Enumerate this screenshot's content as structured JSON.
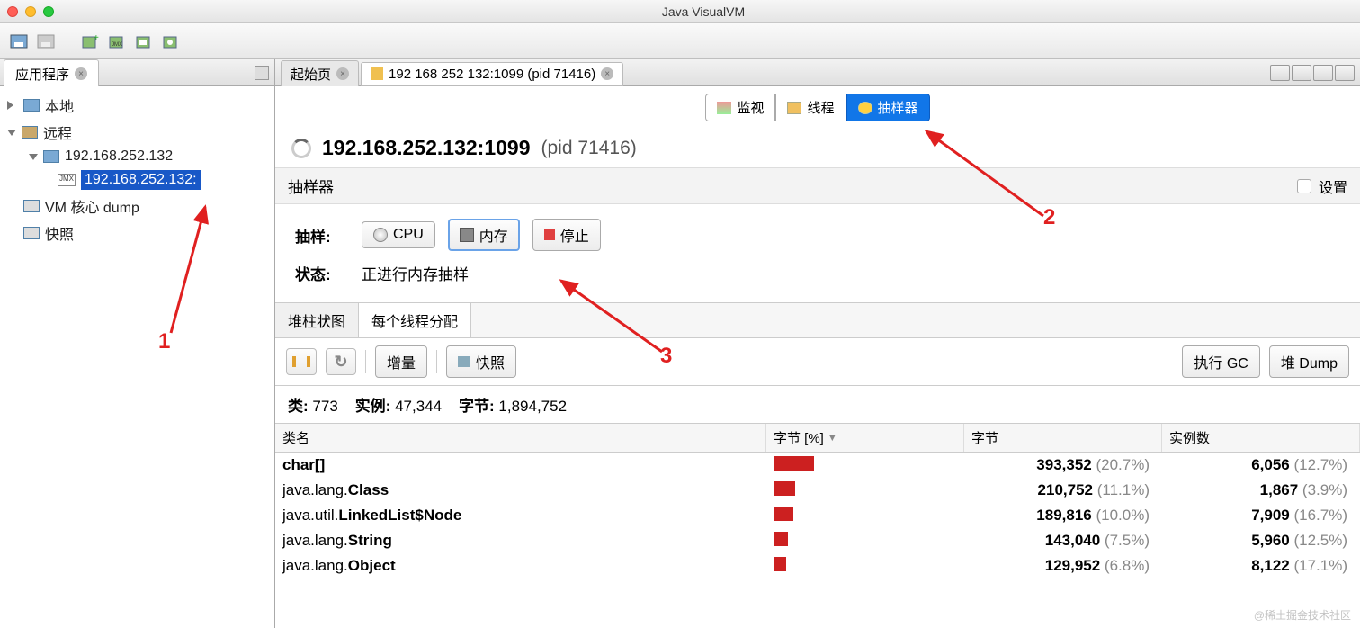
{
  "window": {
    "title": "Java VisualVM"
  },
  "sidebar": {
    "tab_label": "应用程序",
    "tree": {
      "local": "本地",
      "remote": "远程",
      "host": "192.168.252.132",
      "jmx": "192.168.252.132:",
      "vmdump": "VM 核心 dump",
      "snap": "快照"
    }
  },
  "tabs": {
    "start": "起始页",
    "conn": "192 168 252 132:1099 (pid 71416)"
  },
  "viewtabs": {
    "monitor": "监视",
    "threads": "线程",
    "sampler": "抽样器"
  },
  "header": {
    "host": "192.168.252.132:1099",
    "pid": "(pid 71416)"
  },
  "subheader": {
    "title": "抽样器",
    "settings": "设置"
  },
  "controls": {
    "sample_label": "抽样:",
    "cpu": "CPU",
    "mem": "内存",
    "stop": "停止",
    "state_label": "状态:",
    "state_value": "正进行内存抽样"
  },
  "modebar": {
    "histo": "堆柱状图",
    "perthread": "每个线程分配"
  },
  "toolbar2": {
    "delta": "增量",
    "snap": "快照",
    "gc": "执行 GC",
    "heap": "堆 Dump"
  },
  "stats": {
    "classes_label": "类:",
    "classes": "773",
    "inst_label": "实例:",
    "inst": "47,344",
    "bytes_label": "字节:",
    "bytes": "1,894,752"
  },
  "thead": {
    "name": "类名",
    "pct": "字节 [%]",
    "bytes": "字节",
    "inst": "实例数"
  },
  "rows": [
    {
      "pkg": "",
      "cls": "char[]",
      "bar": 22,
      "bytes": "393,352",
      "bpct": "(20.7%)",
      "inst": "6,056",
      "ipct": "(12.7%)"
    },
    {
      "pkg": "java.lang.",
      "cls": "Class",
      "bar": 12,
      "bytes": "210,752",
      "bpct": "(11.1%)",
      "inst": "1,867",
      "ipct": "(3.9%)"
    },
    {
      "pkg": "java.util.",
      "cls": "LinkedList$Node",
      "bar": 11,
      "bytes": "189,816",
      "bpct": "(10.0%)",
      "inst": "7,909",
      "ipct": "(16.7%)"
    },
    {
      "pkg": "java.lang.",
      "cls": "String",
      "bar": 8,
      "bytes": "143,040",
      "bpct": "(7.5%)",
      "inst": "5,960",
      "ipct": "(12.5%)"
    },
    {
      "pkg": "java.lang.",
      "cls": "Object",
      "bar": 7,
      "bytes": "129,952",
      "bpct": "(6.8%)",
      "inst": "8,122",
      "ipct": "(17.1%)"
    }
  ],
  "annotations": {
    "n1": "1",
    "n2": "2",
    "n3": "3"
  },
  "watermark": "@稀土掘金技术社区"
}
